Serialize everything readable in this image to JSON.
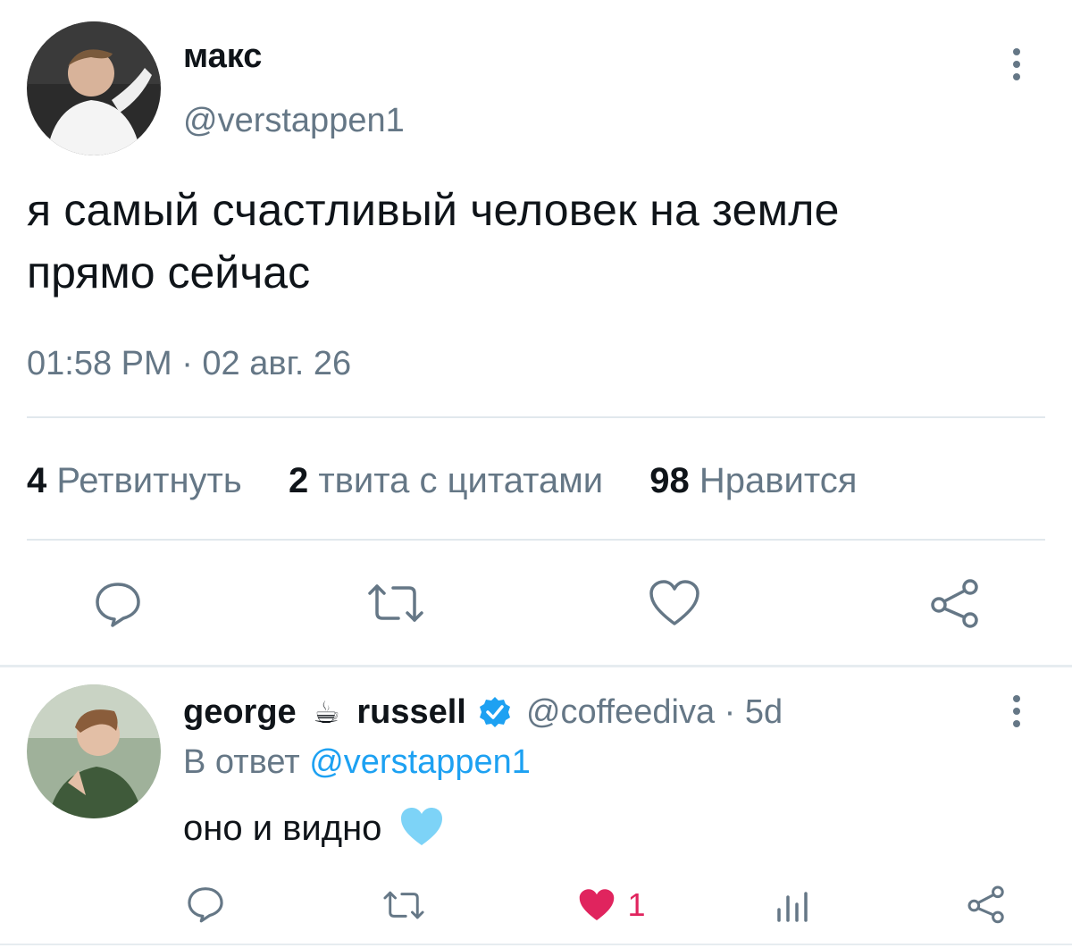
{
  "main_tweet": {
    "display_name": "макс",
    "handle": "@verstappen1",
    "text_line1": "я самый счастливый человек на земле",
    "text_line2": "прямо сейчас",
    "timestamp": "01:58 PM · 02 авг. 26",
    "stats": {
      "retweets_count": "4",
      "retweets_label": "Ретвитнуть",
      "quotes_count": "2",
      "quotes_label": "твита с цитатами",
      "likes_count": "98",
      "likes_label": "Нравится"
    },
    "actions": [
      "reply-icon",
      "retweet-icon",
      "like-icon",
      "share-icon"
    ],
    "menu_icon": "more-vertical-icon"
  },
  "reply_tweet": {
    "name_part1": "george",
    "name_emoji": "☕",
    "name_part2": "russell",
    "verified_icon": "verified-badge-icon",
    "handle_time": "@coffeediva · 5d",
    "reply_to_prefix": "В ответ",
    "reply_to_handle": "@verstappen1",
    "text": "оно и видно",
    "text_emoji": "💙",
    "like_count": "1",
    "actions": [
      "reply-icon",
      "retweet-icon",
      "liked-heart-icon",
      "analytics-icon",
      "share-icon"
    ],
    "menu_icon": "more-vertical-icon"
  },
  "colors": {
    "text": "#0f1419",
    "muted": "#657786",
    "link": "#1da1f2",
    "like_active": "#e0245e",
    "divider": "#e1e8ed"
  }
}
